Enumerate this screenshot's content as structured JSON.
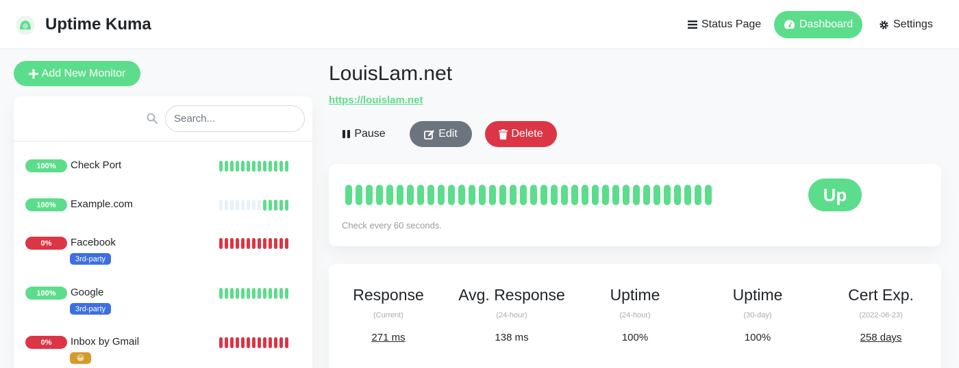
{
  "header": {
    "app_title": "Uptime Kuma",
    "nav": {
      "status_page": "Status Page",
      "dashboard": "Dashboard",
      "settings": "Settings"
    }
  },
  "sidebar": {
    "add_button": "Add New Monitor",
    "search_placeholder": "Search...",
    "monitors": [
      {
        "percent": "100%",
        "name": "Check Port",
        "status": "up",
        "tag": "",
        "beats": [
          "g",
          "g",
          "g",
          "g",
          "g",
          "g",
          "g",
          "g",
          "g",
          "g",
          "g",
          "g",
          "g"
        ]
      },
      {
        "percent": "100%",
        "name": "Example.com",
        "status": "up",
        "tag": "",
        "beats": [
          "e",
          "e",
          "e",
          "e",
          "e",
          "e",
          "e",
          "e",
          "g",
          "g",
          "g",
          "g",
          "g"
        ]
      },
      {
        "percent": "0%",
        "name": "Facebook",
        "status": "down",
        "tag": "3rd-party",
        "beats": [
          "r",
          "r",
          "r",
          "r",
          "r",
          "r",
          "r",
          "r",
          "r",
          "r",
          "r",
          "r",
          "r"
        ]
      },
      {
        "percent": "100%",
        "name": "Google",
        "status": "up",
        "tag": "3rd-party",
        "beats": [
          "g",
          "g",
          "g",
          "g",
          "g",
          "g",
          "g",
          "g",
          "g",
          "g",
          "g",
          "g",
          "g"
        ]
      },
      {
        "percent": "0%",
        "name": "Inbox by Gmail",
        "status": "down",
        "tag": "😀",
        "beats": [
          "r",
          "r",
          "r",
          "r",
          "r",
          "r",
          "r",
          "r",
          "r",
          "r",
          "r",
          "r",
          "r"
        ]
      }
    ]
  },
  "main": {
    "title": "LouisLam.net",
    "url": "https://louislam.net",
    "buttons": {
      "pause": "Pause",
      "edit": "Edit",
      "delete": "Delete"
    },
    "status": "Up",
    "check_text": "Check every 60 seconds.",
    "beat_count": 36,
    "stats": [
      {
        "title": "Response",
        "sub": "(Current)",
        "value": "271 ms",
        "link": true
      },
      {
        "title": "Avg. Response",
        "sub": "(24-hour)",
        "value": "138 ms",
        "link": false
      },
      {
        "title": "Uptime",
        "sub": "(24-hour)",
        "value": "100%",
        "link": false
      },
      {
        "title": "Uptime",
        "sub": "(30-day)",
        "value": "100%",
        "link": false
      },
      {
        "title": "Cert Exp.",
        "sub": "(2022-06-23)",
        "value": "258 days",
        "link": true
      }
    ]
  },
  "colors": {
    "primary": "#5cdd8b",
    "danger": "#dc3545",
    "secondary": "#6c757d",
    "tag": "#3d6fe0",
    "empty_beat": "#e5f3f9"
  }
}
